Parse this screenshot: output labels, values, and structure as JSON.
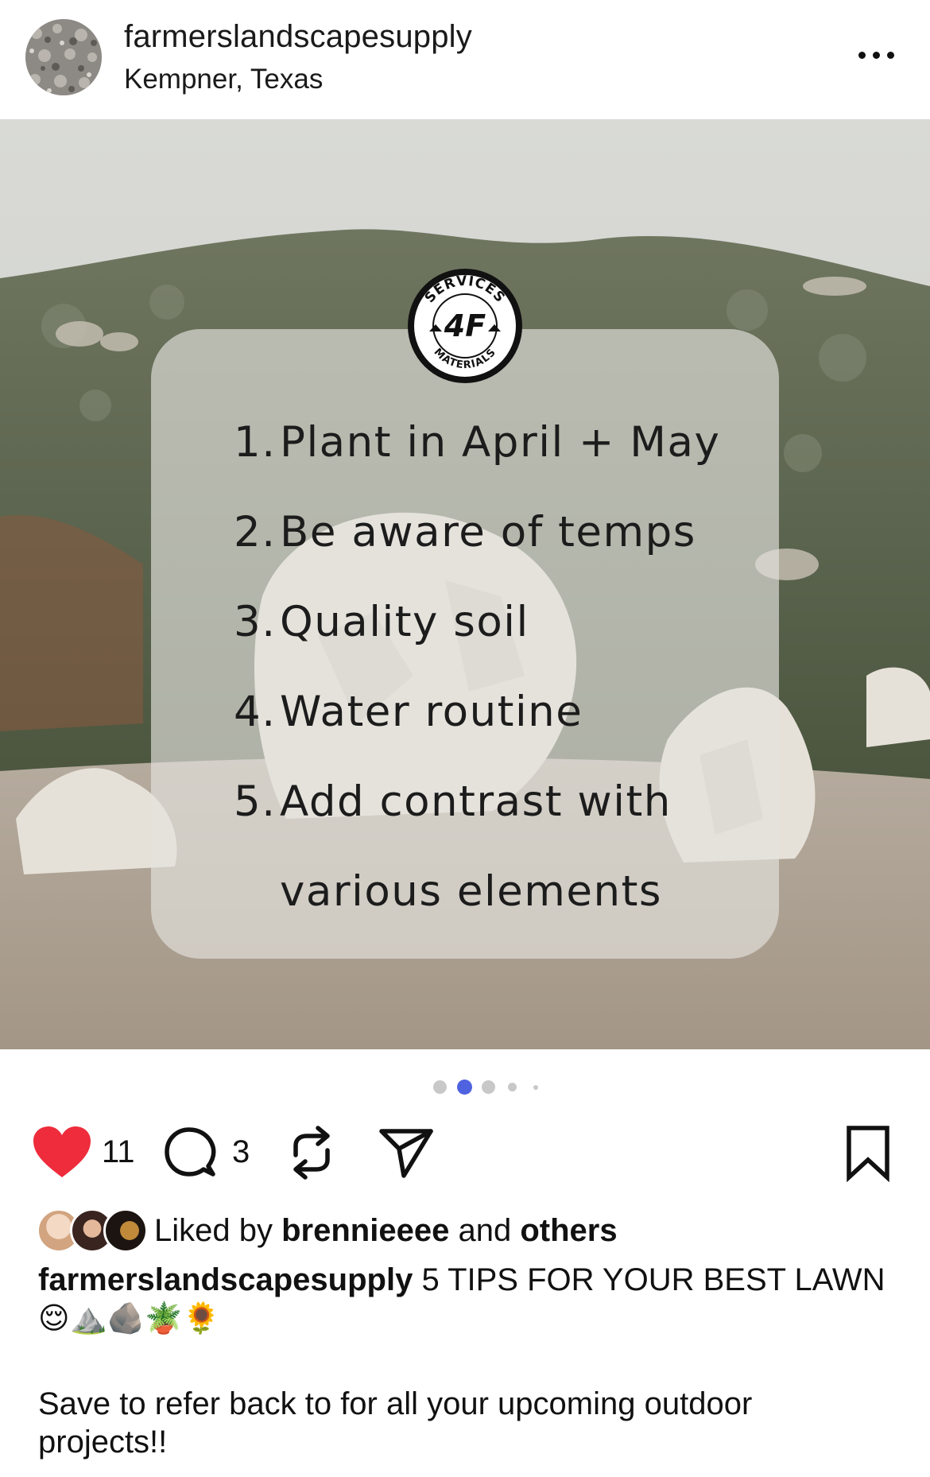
{
  "header": {
    "username": "farmerslandscapesupply",
    "location": "Kempner, Texas",
    "more_icon": "more-horizontal-icon"
  },
  "media": {
    "logo": {
      "top_text": "SERVICES",
      "center_text": "4F",
      "bottom_text": "MATERIALS"
    },
    "tips": [
      {
        "num": "1.",
        "text": "Plant in April + May"
      },
      {
        "num": "2.",
        "text": "Be aware of temps"
      },
      {
        "num": "3.",
        "text": "Quality soil"
      },
      {
        "num": "4.",
        "text": "Water routine"
      },
      {
        "num": "5.",
        "text": "Add contrast with"
      }
    ],
    "tip_continuation": "various elements"
  },
  "carousel": {
    "total": 5,
    "active_index": 1,
    "active_color": "#4f63e0"
  },
  "actions": {
    "like_count": "11",
    "comment_count": "3",
    "like_color": "#ee2c3c",
    "icons": [
      "heart-icon",
      "comment-icon",
      "repost-icon",
      "share-icon",
      "bookmark-icon"
    ]
  },
  "likes": {
    "prefix": "Liked by",
    "user": "brennieeee",
    "middle": "and",
    "others": "others"
  },
  "caption": {
    "username": "farmerslandscapesupply",
    "text": "5 TIPS FOR YOUR BEST LAWN",
    "emojis": "😌⛰️🪨🪴🌻",
    "note": "Save to refer back to for all your upcoming outdoor projects!!"
  }
}
